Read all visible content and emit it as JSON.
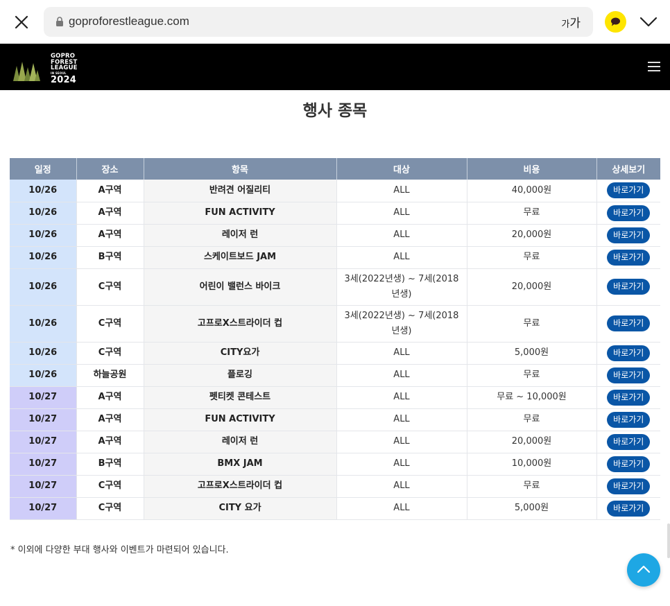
{
  "browser": {
    "url": "goproforestleague.com",
    "text_size_small": "가",
    "text_size_large": "가"
  },
  "site": {
    "logo_lines": [
      "GOPRO",
      "FOREST",
      "LEAGUE"
    ],
    "logo_sub": "IN SEOUL",
    "logo_year": "2024"
  },
  "page_title": "행사 종목",
  "table": {
    "headers": [
      "일정",
      "장소",
      "항목",
      "대상",
      "비용",
      "상세보기"
    ],
    "rows": [
      {
        "date": "10/26",
        "place": "A구역",
        "item": "반려견 어질리티",
        "target": "ALL",
        "cost": "40,000원",
        "action": "바로가기"
      },
      {
        "date": "10/26",
        "place": "A구역",
        "item": "FUN ACTIVITY",
        "target": "ALL",
        "cost": "무료",
        "action": "바로가기"
      },
      {
        "date": "10/26",
        "place": "A구역",
        "item": "레이저 런",
        "target": "ALL",
        "cost": "20,000원",
        "action": "바로가기"
      },
      {
        "date": "10/26",
        "place": "B구역",
        "item": "스케이트보드 JAM",
        "target": "ALL",
        "cost": "무료",
        "action": "바로가기"
      },
      {
        "date": "10/26",
        "place": "C구역",
        "item": "어린이 밸런스 바이크",
        "target": "3세(2022년생) ~ 7세(2018년생)",
        "cost": "20,000원",
        "action": "바로가기"
      },
      {
        "date": "10/26",
        "place": "C구역",
        "item": "고프로X스트라이더 컵",
        "target": "3세(2022년생) ~ 7세(2018년생)",
        "cost": "무료",
        "action": "바로가기"
      },
      {
        "date": "10/26",
        "place": "C구역",
        "item": "CITY요가",
        "target": "ALL",
        "cost": "5,000원",
        "action": "바로가기"
      },
      {
        "date": "10/26",
        "place": "하늘공원",
        "item": "플로깅",
        "target": "ALL",
        "cost": "무료",
        "action": "바로가기"
      },
      {
        "date": "10/27",
        "place": "A구역",
        "item": "펫티켓 콘테스트",
        "target": "ALL",
        "cost": "무료 ~ 10,000원",
        "action": "바로가기"
      },
      {
        "date": "10/27",
        "place": "A구역",
        "item": "FUN ACTIVITY",
        "target": "ALL",
        "cost": "무료",
        "action": "바로가기"
      },
      {
        "date": "10/27",
        "place": "A구역",
        "item": "레이저 런",
        "target": "ALL",
        "cost": "20,000원",
        "action": "바로가기"
      },
      {
        "date": "10/27",
        "place": "B구역",
        "item": "BMX JAM",
        "target": "ALL",
        "cost": "10,000원",
        "action": "바로가기"
      },
      {
        "date": "10/27",
        "place": "C구역",
        "item": "고프로X스트라이더 컵",
        "target": "ALL",
        "cost": "무료",
        "action": "바로가기"
      },
      {
        "date": "10/27",
        "place": "C구역",
        "item": "CITY 요가",
        "target": "ALL",
        "cost": "5,000원",
        "action": "바로가기"
      }
    ]
  },
  "note": "* 이외에 다양한 부대 행사와 이벤트가 마련되어 있습니다.",
  "icons": [
    "close-icon",
    "lock-icon",
    "kakao-talk-icon",
    "chevron-down-icon",
    "hamburger-menu-icon",
    "arrow-up-icon"
  ],
  "colors": {
    "header_bg": "#000000",
    "table_header_bg": "#7d90aa",
    "date_1026_bg": "#d3e4fb",
    "date_1027_bg": "#cfcdf9",
    "button_bg": "#0a56a6",
    "scroll_top_bg": "#1ea7e4",
    "kakao_yellow": "#fee500"
  }
}
